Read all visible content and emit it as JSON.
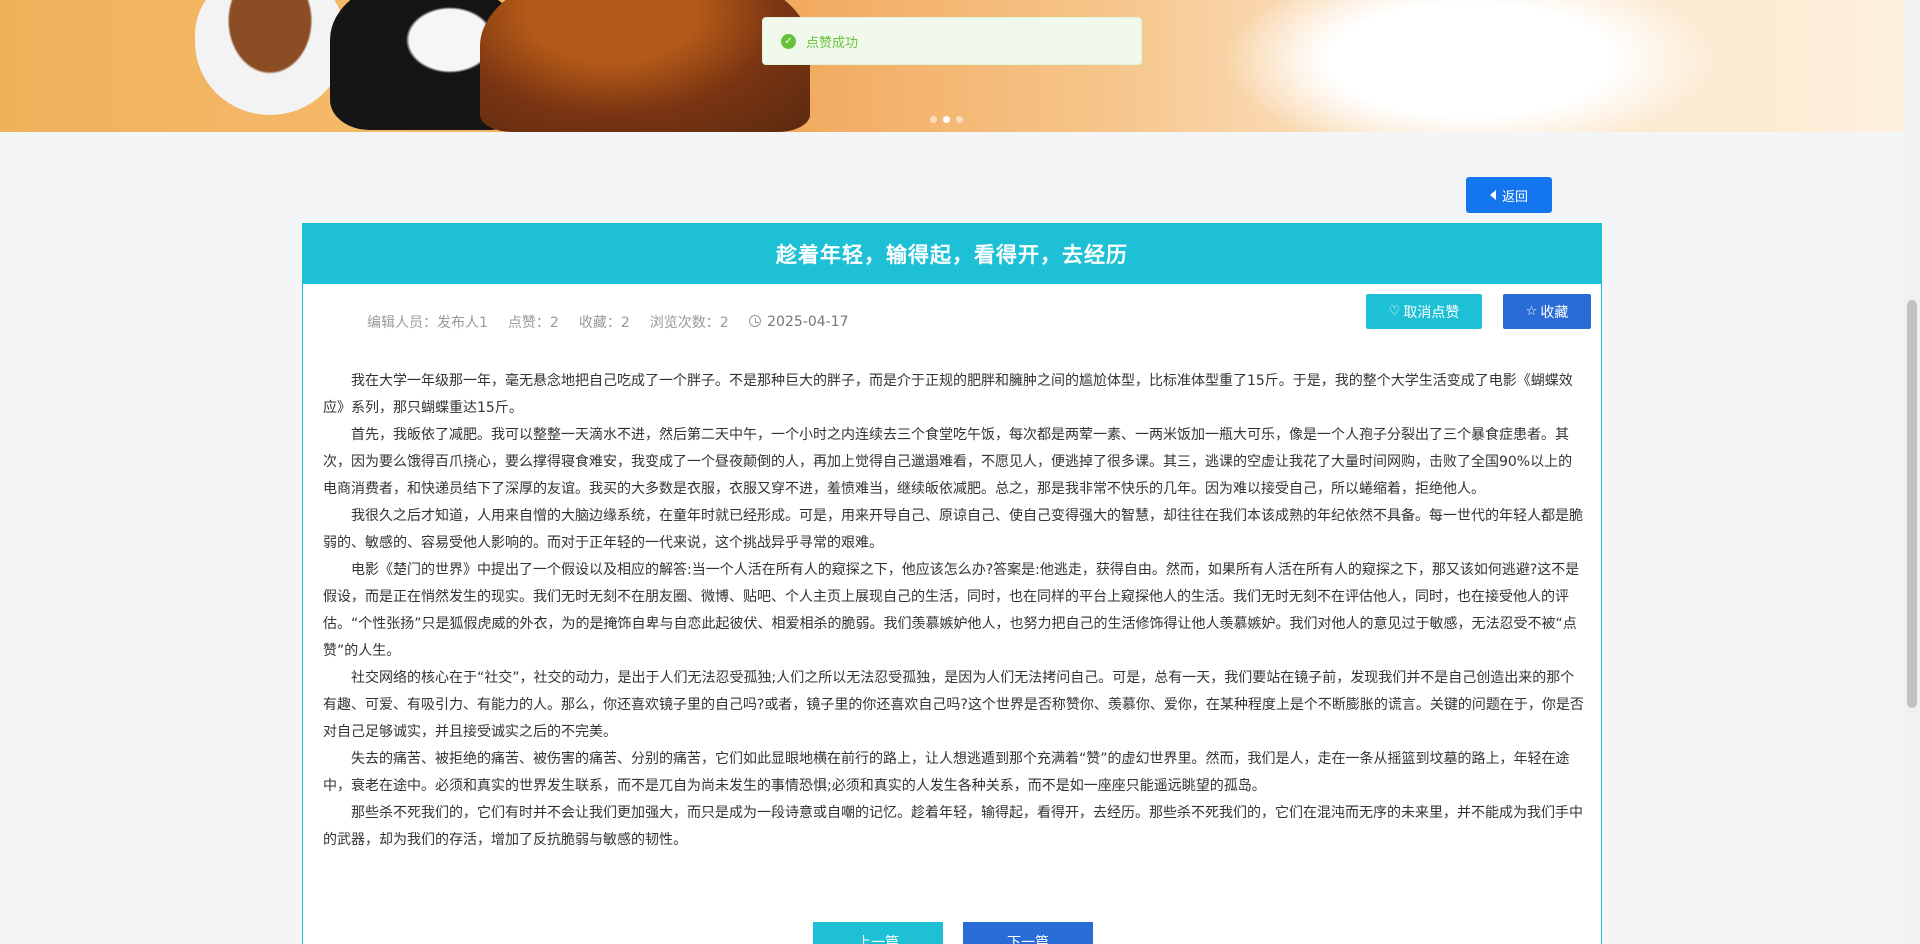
{
  "toast": {
    "text": "点赞成功",
    "icon": "check-circle-icon"
  },
  "back_button": {
    "label": "返回",
    "icon": "caret-left-icon"
  },
  "article": {
    "title": "趁着年轻，输得起，看得开，去经历",
    "meta": {
      "editor": "编辑人员：发布人1",
      "likes": "点赞：2",
      "favorites": "收藏：2",
      "views": "浏览次数：2",
      "date": "2025-04-17"
    },
    "unlike_button": {
      "label": "取消点赞",
      "icon": "heart-icon"
    },
    "favorite_button": {
      "label": "收藏",
      "icon": "star-icon"
    },
    "paragraphs": [
      "我在大学一年级那一年，毫无悬念地把自己吃成了一个胖子。不是那种巨大的胖子，而是介于正规的肥胖和臃肿之间的尴尬体型，比标准体型重了15斤。于是，我的整个大学生活变成了电影《蝴蝶效应》系列，那只蝴蝶重达15斤。",
      "首先，我皈依了减肥。我可以整整一天滴水不进，然后第二天中午，一个小时之内连续去三个食堂吃午饭，每次都是两荤一素、一两米饭加一瓶大可乐，像是一个人孢子分裂出了三个暴食症患者。其次，因为要么饿得百爪挠心，要么撑得寝食难安，我变成了一个昼夜颠倒的人，再加上觉得自己邋遢难看，不愿见人，便逃掉了很多课。其三，逃课的空虚让我花了大量时间网购，击败了全国90%以上的电商消费者，和快递员结下了深厚的友谊。我买的大多数是衣服，衣服又穿不进，羞愤难当，继续皈依减肥。总之，那是我非常不快乐的几年。因为难以接受自己，所以蜷缩着，拒绝他人。",
      "我很久之后才知道，人用来自憎的大脑边缘系统，在童年时就已经形成。可是，用来开导自己、原谅自己、使自己变得强大的智慧，却往往在我们本该成熟的年纪依然不具备。每一世代的年轻人都是脆弱的、敏感的、容易受他人影响的。而对于正年轻的一代来说，这个挑战异乎寻常的艰难。",
      "电影《楚门的世界》中提出了一个假设以及相应的解答:当一个人活在所有人的窥探之下，他应该怎么办?答案是:他逃走，获得自由。然而，如果所有人活在所有人的窥探之下，那又该如何逃避?这不是假设，而是正在悄然发生的现实。我们无时无刻不在朋友圈、微博、贴吧、个人主页上展现自己的生活，同时，也在同样的平台上窥探他人的生活。我们无时无刻不在评估他人，同时，也在接受他人的评估。“个性张扬”只是狐假虎威的外衣，为的是掩饰自卑与自恋此起彼伏、相爱相杀的脆弱。我们羡慕嫉妒他人，也努力把自己的生活修饰得让他人羡慕嫉妒。我们对他人的意见过于敏感，无法忍受不被“点赞”的人生。",
      "社交网络的核心在于“社交”，社交的动力，是出于人们无法忍受孤独;人们之所以无法忍受孤独，是因为人们无法拷问自己。可是，总有一天，我们要站在镜子前，发现我们并不是自己创造出来的那个有趣、可爱、有吸引力、有能力的人。那么，你还喜欢镜子里的自己吗?或者，镜子里的你还喜欢自己吗?这个世界是否称赞你、羡慕你、爱你，在某种程度上是个不断膨胀的谎言。关键的问题在于，你是否对自己足够诚实，并且接受诚实之后的不完美。",
      "失去的痛苦、被拒绝的痛苦、被伤害的痛苦、分别的痛苦，它们如此显眼地横在前行的路上，让人想逃遁到那个充满着“赞”的虚幻世界里。然而，我们是人，走在一条从摇篮到坟墓的路上，年轻在途中，衰老在途中。必须和真实的世界发生联系，而不是兀自为尚未发生的事情恐惧;必须和真实的人发生各种关系，而不是如一座座只能遥远眺望的孤岛。",
      "那些杀不死我们的，它们有时并不会让我们更加强大，而只是成为一段诗意或自嘲的记忆。趁着年轻，输得起，看得开，去经历。那些杀不死我们的，它们在混沌而无序的未来里，并不能成为我们手中的武器，却为我们的存活，增加了反抗脆弱与敏感的韧性。"
    ],
    "prev_button": "上一篇",
    "next_button": "下一篇"
  },
  "colors": {
    "primary": "#1476ee",
    "cyan": "#1ec0d6",
    "blue": "#2a6cd6",
    "success": "#67c23a"
  }
}
